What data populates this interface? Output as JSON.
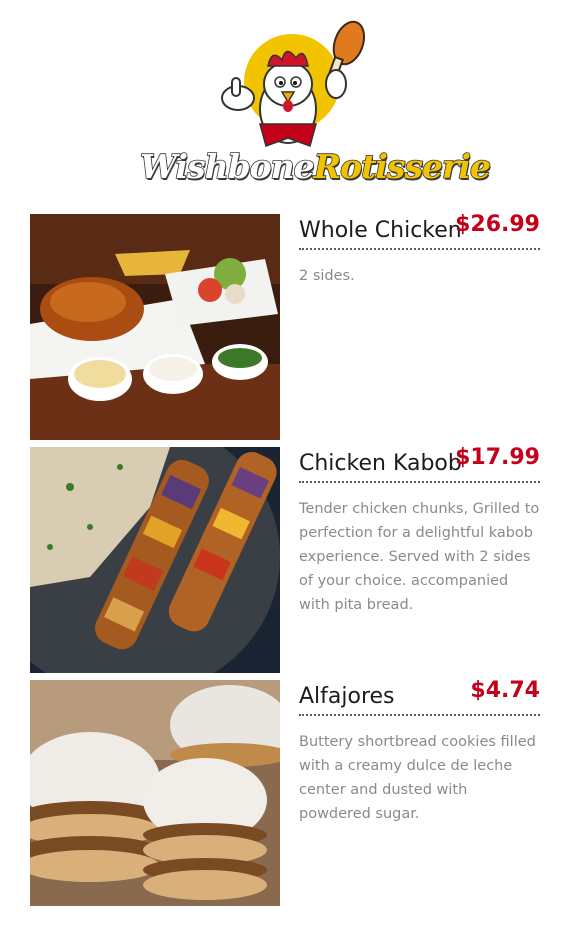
{
  "brand": {
    "name_part1": "Wishbone",
    "name_part2": "Rotisserie"
  },
  "menu": [
    {
      "name": "Whole Chicken",
      "price": "$26.99",
      "description": "2 sides.",
      "image": "whole-chicken-photo"
    },
    {
      "name": "Chicken Kabob",
      "price": "$17.99",
      "description": "Tender chicken chunks, Grilled to perfection for a delightful kabob experience. Served with 2 sides of your choice. accompanied with pita bread.",
      "image": "chicken-kabob-photo"
    },
    {
      "name": "Alfajores",
      "price": "$4.74",
      "description": "Buttery shortbread cookies filled with a creamy dulce de leche center and dusted with powdered sugar.",
      "image": "alfajores-photo"
    }
  ],
  "colors": {
    "price": "#c4001b",
    "accent_yellow": "#f2c400"
  }
}
